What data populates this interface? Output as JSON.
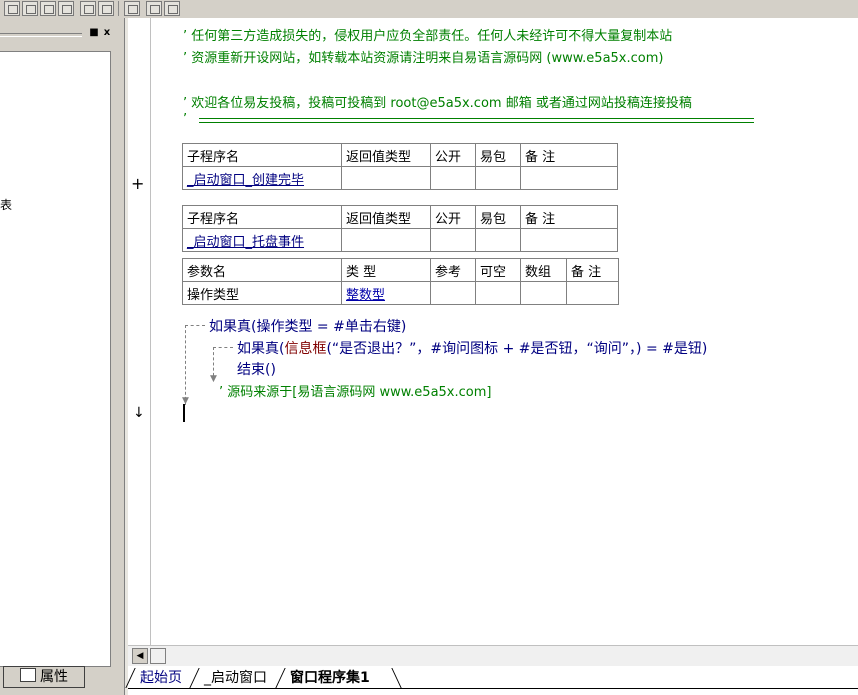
{
  "left_panel": {
    "partial_text": "表",
    "min_glyph": "■",
    "close_glyph": "x",
    "props_tab_label": "属性"
  },
  "code": {
    "comments": [
      "’ 任何第三方造成损失的，侵权用户应负全部责任。任何人未经许可不得大量复制本站",
      "’ 资源重新开设网站，如转载本站资源请注明来自易语言源码网 (www.e5a5x.com)",
      "’ 欢迎各位易友投稿，投稿可投稿到   root@e5a5x.com  邮箱 或者通过网站投稿连接投稿",
      "’"
    ],
    "table1": {
      "headers": [
        "子程序名",
        "返回值类型",
        "公开",
        "易包",
        "备 注"
      ],
      "row": [
        "_启动窗口_创建完毕",
        "",
        "",
        "",
        ""
      ],
      "expander": "+"
    },
    "table2": {
      "headers": [
        "子程序名",
        "返回值类型",
        "公开",
        "易包",
        "备 注"
      ],
      "row": [
        "_启动窗口_托盘事件",
        "",
        "",
        "",
        ""
      ],
      "param_headers": [
        "参数名",
        "类 型",
        "参考",
        "可空",
        "数组",
        "备 注"
      ],
      "param_row": [
        "操作类型",
        "整数型",
        "",
        "",
        "",
        ""
      ]
    },
    "lines": {
      "if1_kw": "如果真",
      "if1_rest": "(操作类型 = #单击右键)",
      "if2_kw": "如果真",
      "if2_paren": "(",
      "if2_func": "信息框",
      "if2_args": "(“是否退出？”，#询问图标 + #是否钮，“询问”，) = #是钮)",
      "end_kw": "结束",
      "end_args": "()",
      "source_comment": "’ 源码来源于[易语言源码网 www.e5a5x.com]"
    },
    "gutter_arrow": "↓"
  },
  "tabs": [
    {
      "label": "起始页",
      "active": false,
      "color": "#000080"
    },
    {
      "label": "_启动窗口",
      "active": false,
      "color": "#000000"
    },
    {
      "label": "窗口程序集1",
      "active": true,
      "color": "#000000"
    }
  ],
  "colors": {
    "comment": "#008000",
    "keyword": "#000080",
    "function": "#800000",
    "args": "#008080",
    "type_link": "#0000aa",
    "panel_bg": "#d4d0c8"
  }
}
